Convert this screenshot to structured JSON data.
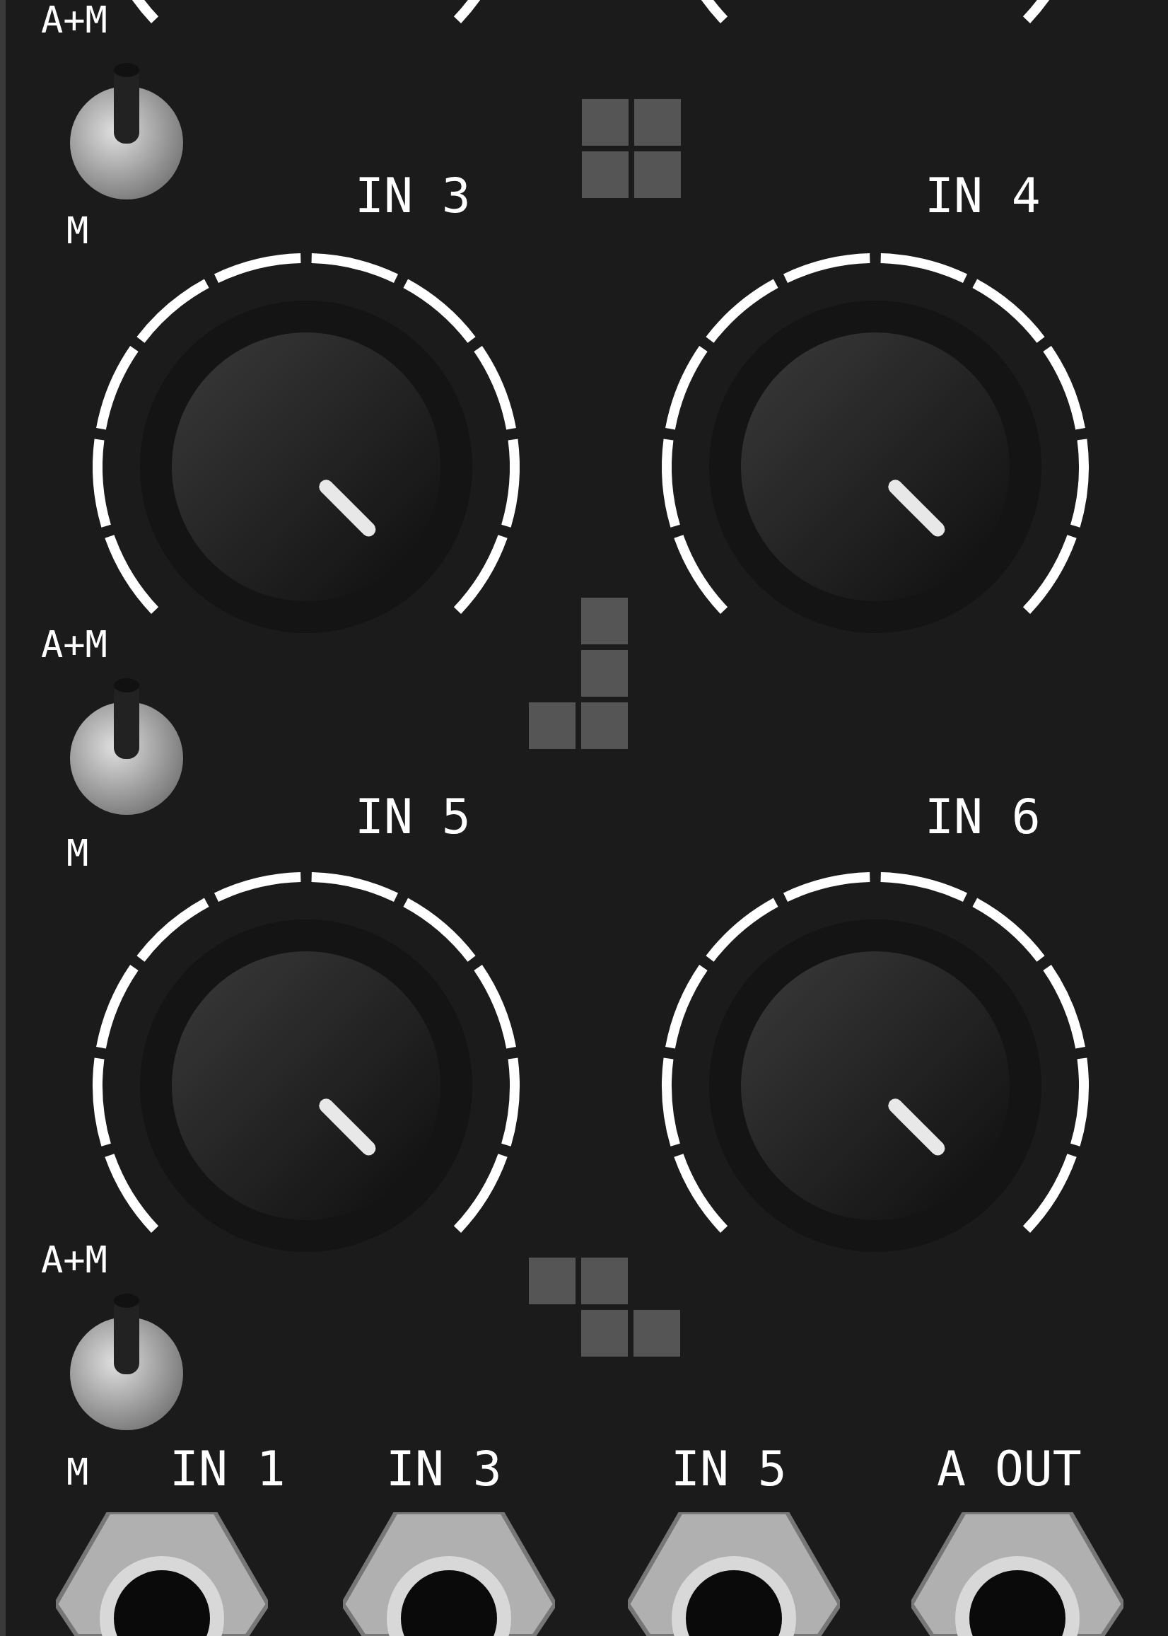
{
  "rows": [
    {
      "toggle": {
        "top_label": "A+M",
        "bottom_label": "M",
        "on": true
      },
      "knobs": [
        {
          "label": "IN 3"
        },
        {
          "label": "IN 4"
        }
      ]
    },
    {
      "toggle": {
        "top_label": "A+M",
        "bottom_label": "M",
        "on": true
      },
      "knobs": [
        {
          "label": "IN 5"
        },
        {
          "label": "IN 6"
        }
      ]
    },
    {
      "toggle": {
        "top_label": "A+M",
        "bottom_label": "M",
        "on": true
      },
      "knobs": []
    }
  ],
  "jacks": [
    {
      "label": "IN 1"
    },
    {
      "label": "IN 3"
    },
    {
      "label": "IN 5"
    },
    {
      "label": "A OUT"
    }
  ]
}
